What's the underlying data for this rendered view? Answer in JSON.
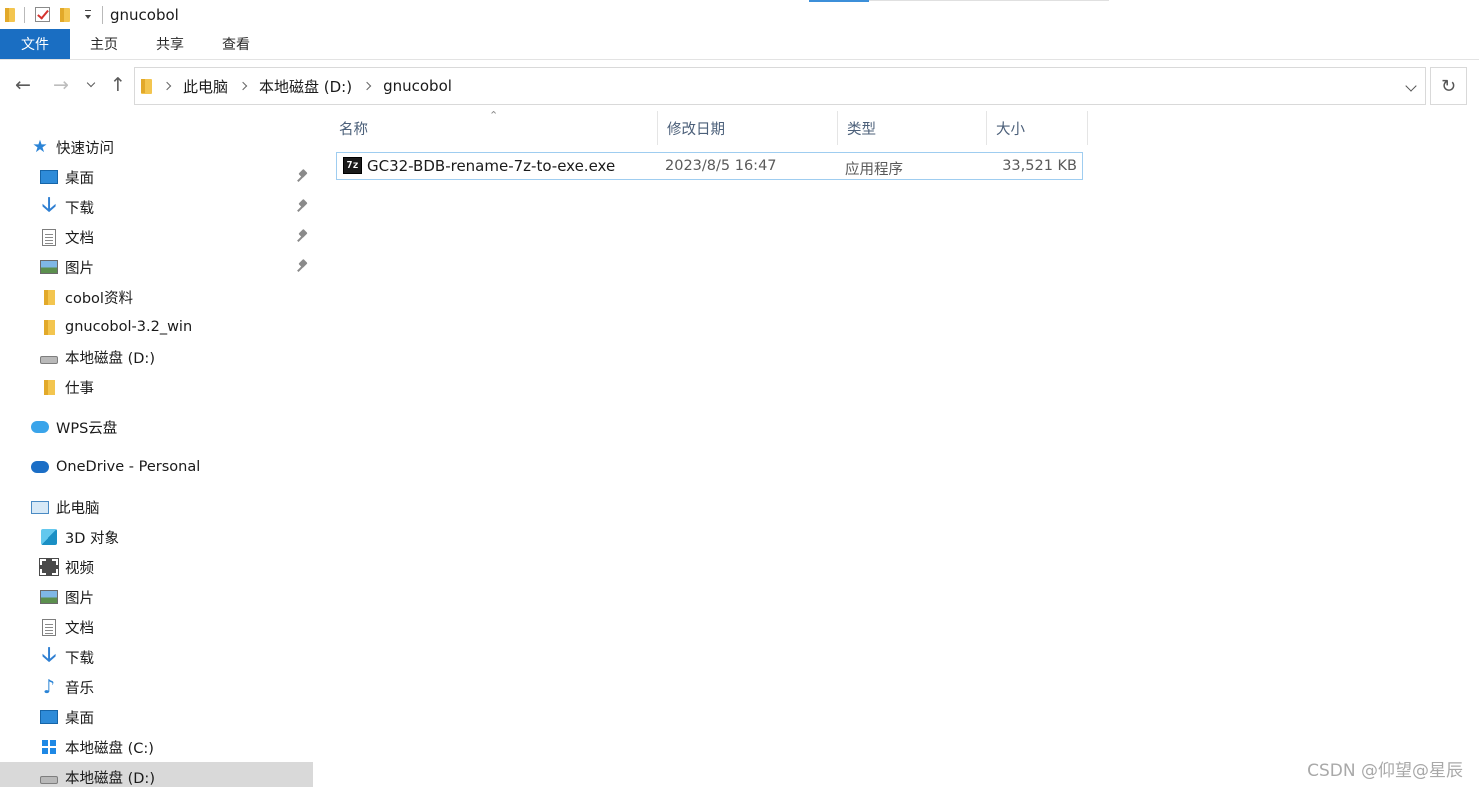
{
  "titlebar": {
    "title": "gnucobol"
  },
  "ribbon": {
    "tabs": [
      {
        "label": "文件"
      },
      {
        "label": "主页"
      },
      {
        "label": "共享"
      },
      {
        "label": "查看"
      }
    ]
  },
  "nav": {
    "breadcrumbs": [
      "此电脑",
      "本地磁盘 (D:)",
      "gnucobol"
    ]
  },
  "sidebar": {
    "quick_access": {
      "label": "快速访问",
      "items": [
        {
          "label": "桌面",
          "icon": "desktop-icon",
          "pinned": true
        },
        {
          "label": "下载",
          "icon": "download-icon",
          "pinned": true
        },
        {
          "label": "文档",
          "icon": "document-icon",
          "pinned": true
        },
        {
          "label": "图片",
          "icon": "picture-icon",
          "pinned": true
        },
        {
          "label": "cobol资料",
          "icon": "folder-icon"
        },
        {
          "label": "gnucobol-3.2_win",
          "icon": "folder-icon"
        },
        {
          "label": "本地磁盘 (D:)",
          "icon": "drive-icon"
        },
        {
          "label": "仕事",
          "icon": "folder-icon"
        }
      ]
    },
    "wps": {
      "label": "WPS云盘"
    },
    "onedrive": {
      "label": "OneDrive - Personal"
    },
    "this_pc": {
      "label": "此电脑",
      "items": [
        {
          "label": "3D 对象",
          "icon": "3d-objects-icon"
        },
        {
          "label": "视频",
          "icon": "video-icon"
        },
        {
          "label": "图片",
          "icon": "picture-icon"
        },
        {
          "label": "文档",
          "icon": "document-icon"
        },
        {
          "label": "下载",
          "icon": "download-icon"
        },
        {
          "label": "音乐",
          "icon": "music-icon"
        },
        {
          "label": "桌面",
          "icon": "desktop-icon"
        },
        {
          "label": "本地磁盘 (C:)",
          "icon": "windows-drive-icon"
        },
        {
          "label": "本地磁盘 (D:)",
          "icon": "drive-icon",
          "selected": true
        }
      ]
    }
  },
  "filelist": {
    "columns": {
      "name": "名称",
      "date": "修改日期",
      "type": "类型",
      "size": "大小"
    },
    "rows": [
      {
        "icon_text": "7z",
        "name": "GC32-BDB-rename-7z-to-exe.exe",
        "date": "2023/8/5 16:47",
        "type": "应用程序",
        "size": "33,521 KB"
      }
    ]
  },
  "watermark": "CSDN @仰望@星辰",
  "colors": {
    "accent": "#1a6ec2",
    "selection_border": "#9fcdf0",
    "sidebar_selected": "#d9d9d9"
  }
}
